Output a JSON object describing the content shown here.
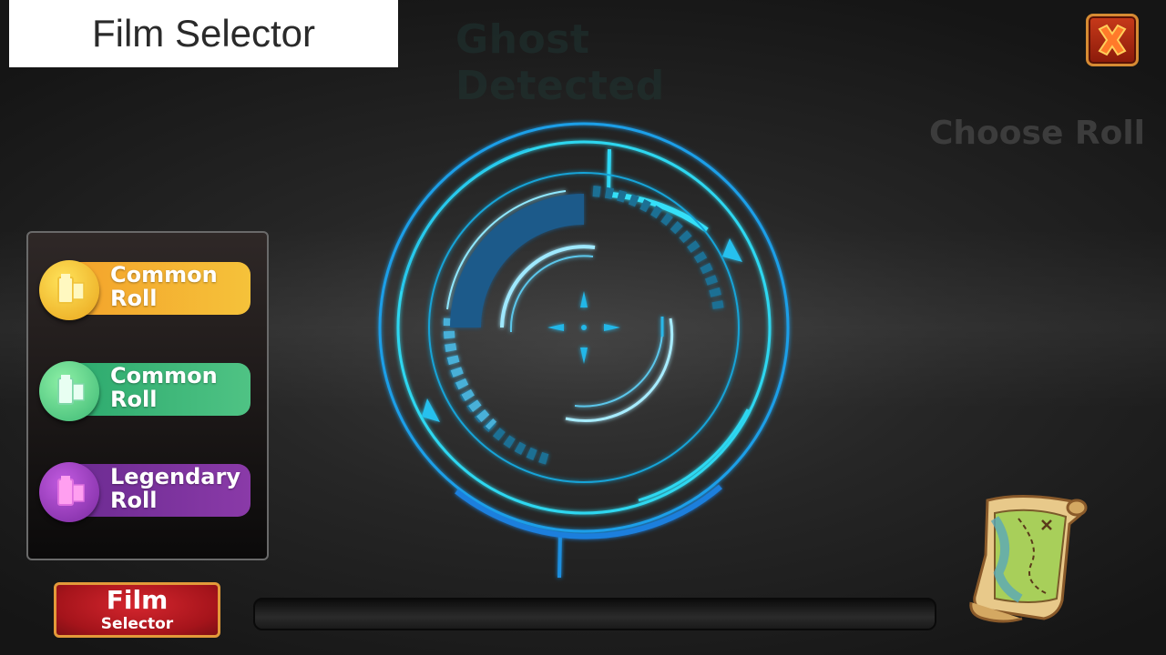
{
  "header": {
    "title": "Film Selector",
    "status_text": "Ghost Detected",
    "choose_label": "Choose Roll"
  },
  "rolls": [
    {
      "line1": "Common",
      "line2": "Roll",
      "pill_color": "#f5b731",
      "circle_color": "#f3c92a",
      "icon": "film-canister-icon"
    },
    {
      "line1": "Common",
      "line2": "Roll",
      "pill_color": "#39b27a",
      "circle_color": "#5bd08a",
      "icon": "film-canister-icon"
    },
    {
      "line1": "Legendary",
      "line2": "Roll",
      "pill_color": "#7c2fa0",
      "circle_color": "#a03ac8",
      "icon": "film-canister-icon"
    }
  ],
  "film_button": {
    "line1": "Film",
    "line2": "Selector"
  },
  "progress": {
    "value": 0.0
  },
  "icons": {
    "close": "close-icon",
    "map": "treasure-map-icon",
    "scanner": "ghost-scanner-reticle"
  },
  "colors": {
    "accent_cyan": "#2fd0f0",
    "close_red": "#b02a14",
    "button_red": "#c41d24"
  }
}
